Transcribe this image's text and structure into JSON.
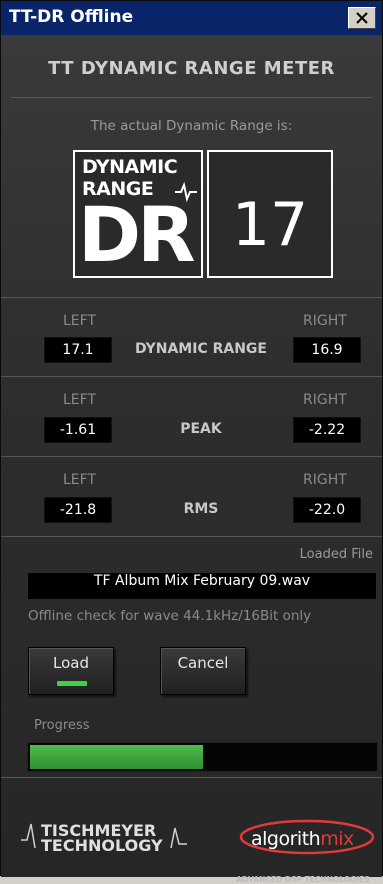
{
  "window": {
    "title": "TT-DR Offline",
    "close_label": "✕"
  },
  "header": {
    "title": "TT DYNAMIC RANGE METER"
  },
  "dr": {
    "intro": "The actual Dynamic Range is:",
    "logo_line1": "DYNAMIC",
    "logo_line2": "RANGE",
    "logo_big": "DR",
    "value": "17"
  },
  "meters": {
    "left_label": "LEFT",
    "right_label": "RIGHT",
    "rows": [
      {
        "name": "DYNAMIC RANGE",
        "left": "17.1",
        "right": "16.9"
      },
      {
        "name": "PEAK",
        "left": "-1.61",
        "right": "-2.22"
      },
      {
        "name": "RMS",
        "left": "-21.8",
        "right": "-22.0"
      }
    ]
  },
  "file": {
    "loaded_label": "Loaded File",
    "name": "TF Album Mix February 09.wav",
    "note": "Offline check for wave 44.1kHz/16Bit only"
  },
  "buttons": {
    "load": "Load",
    "cancel": "Cancel"
  },
  "progress": {
    "label": "Progress",
    "fraction": 0.5
  },
  "footer": {
    "tisch_line1": "TISCHMEYER",
    "tisch_line2": "TECHNOLOGY",
    "algo_main": "algorith",
    "algo_mix": "mix",
    "algo_tag": "ADVANCED DSP TECHNOLOGIES"
  },
  "colors": {
    "progress_fill": "#3fa83f",
    "led": "#3fd04a",
    "title_bar": "#0a246a",
    "brand_red": "#e23a3a"
  }
}
